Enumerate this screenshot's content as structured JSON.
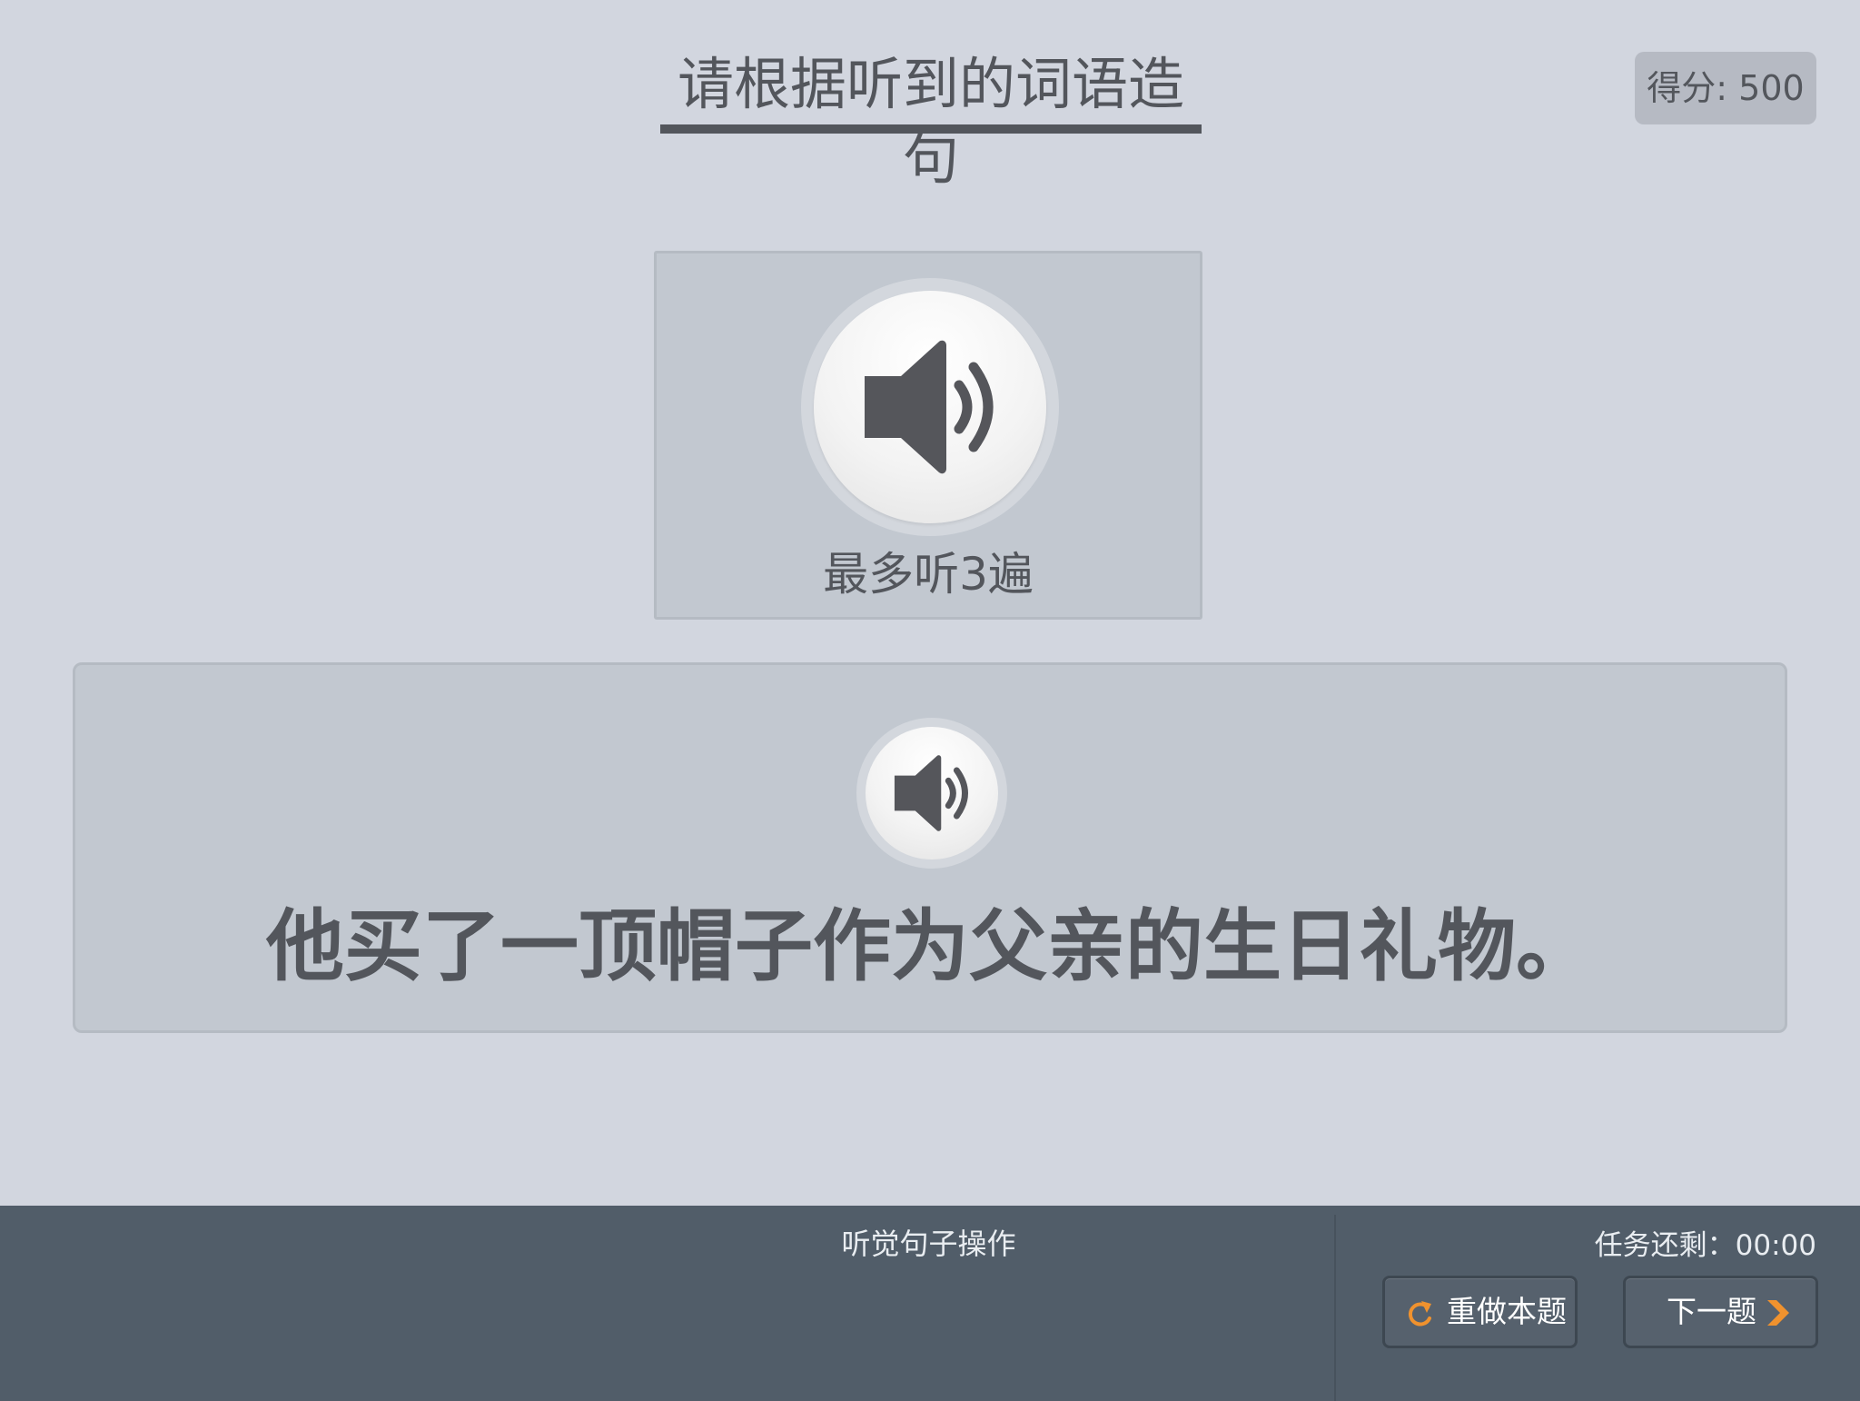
{
  "header": {
    "title": "请根据听到的词语造句",
    "score": "得分: 500"
  },
  "audio_card": {
    "icon": "speaker-icon",
    "limit_text": "最多听3遍"
  },
  "sentence_card": {
    "icon": "speaker-icon",
    "sentence": "他买了一顶帽子作为父亲的生日礼物。"
  },
  "bottom_bar": {
    "operation_title": "听觉句子操作",
    "timer": "任务还剩：00:00",
    "redo_button": {
      "label": "重做本题",
      "icon": "refresh-icon"
    },
    "next_button": {
      "label": "下一题",
      "icon": "chevron-right-icon"
    }
  },
  "colors": {
    "background": "#d2d6df",
    "card": "#c2c8d0",
    "text": "#53565c",
    "bottom_bar": "#515d69",
    "accent": "#f0922e"
  }
}
